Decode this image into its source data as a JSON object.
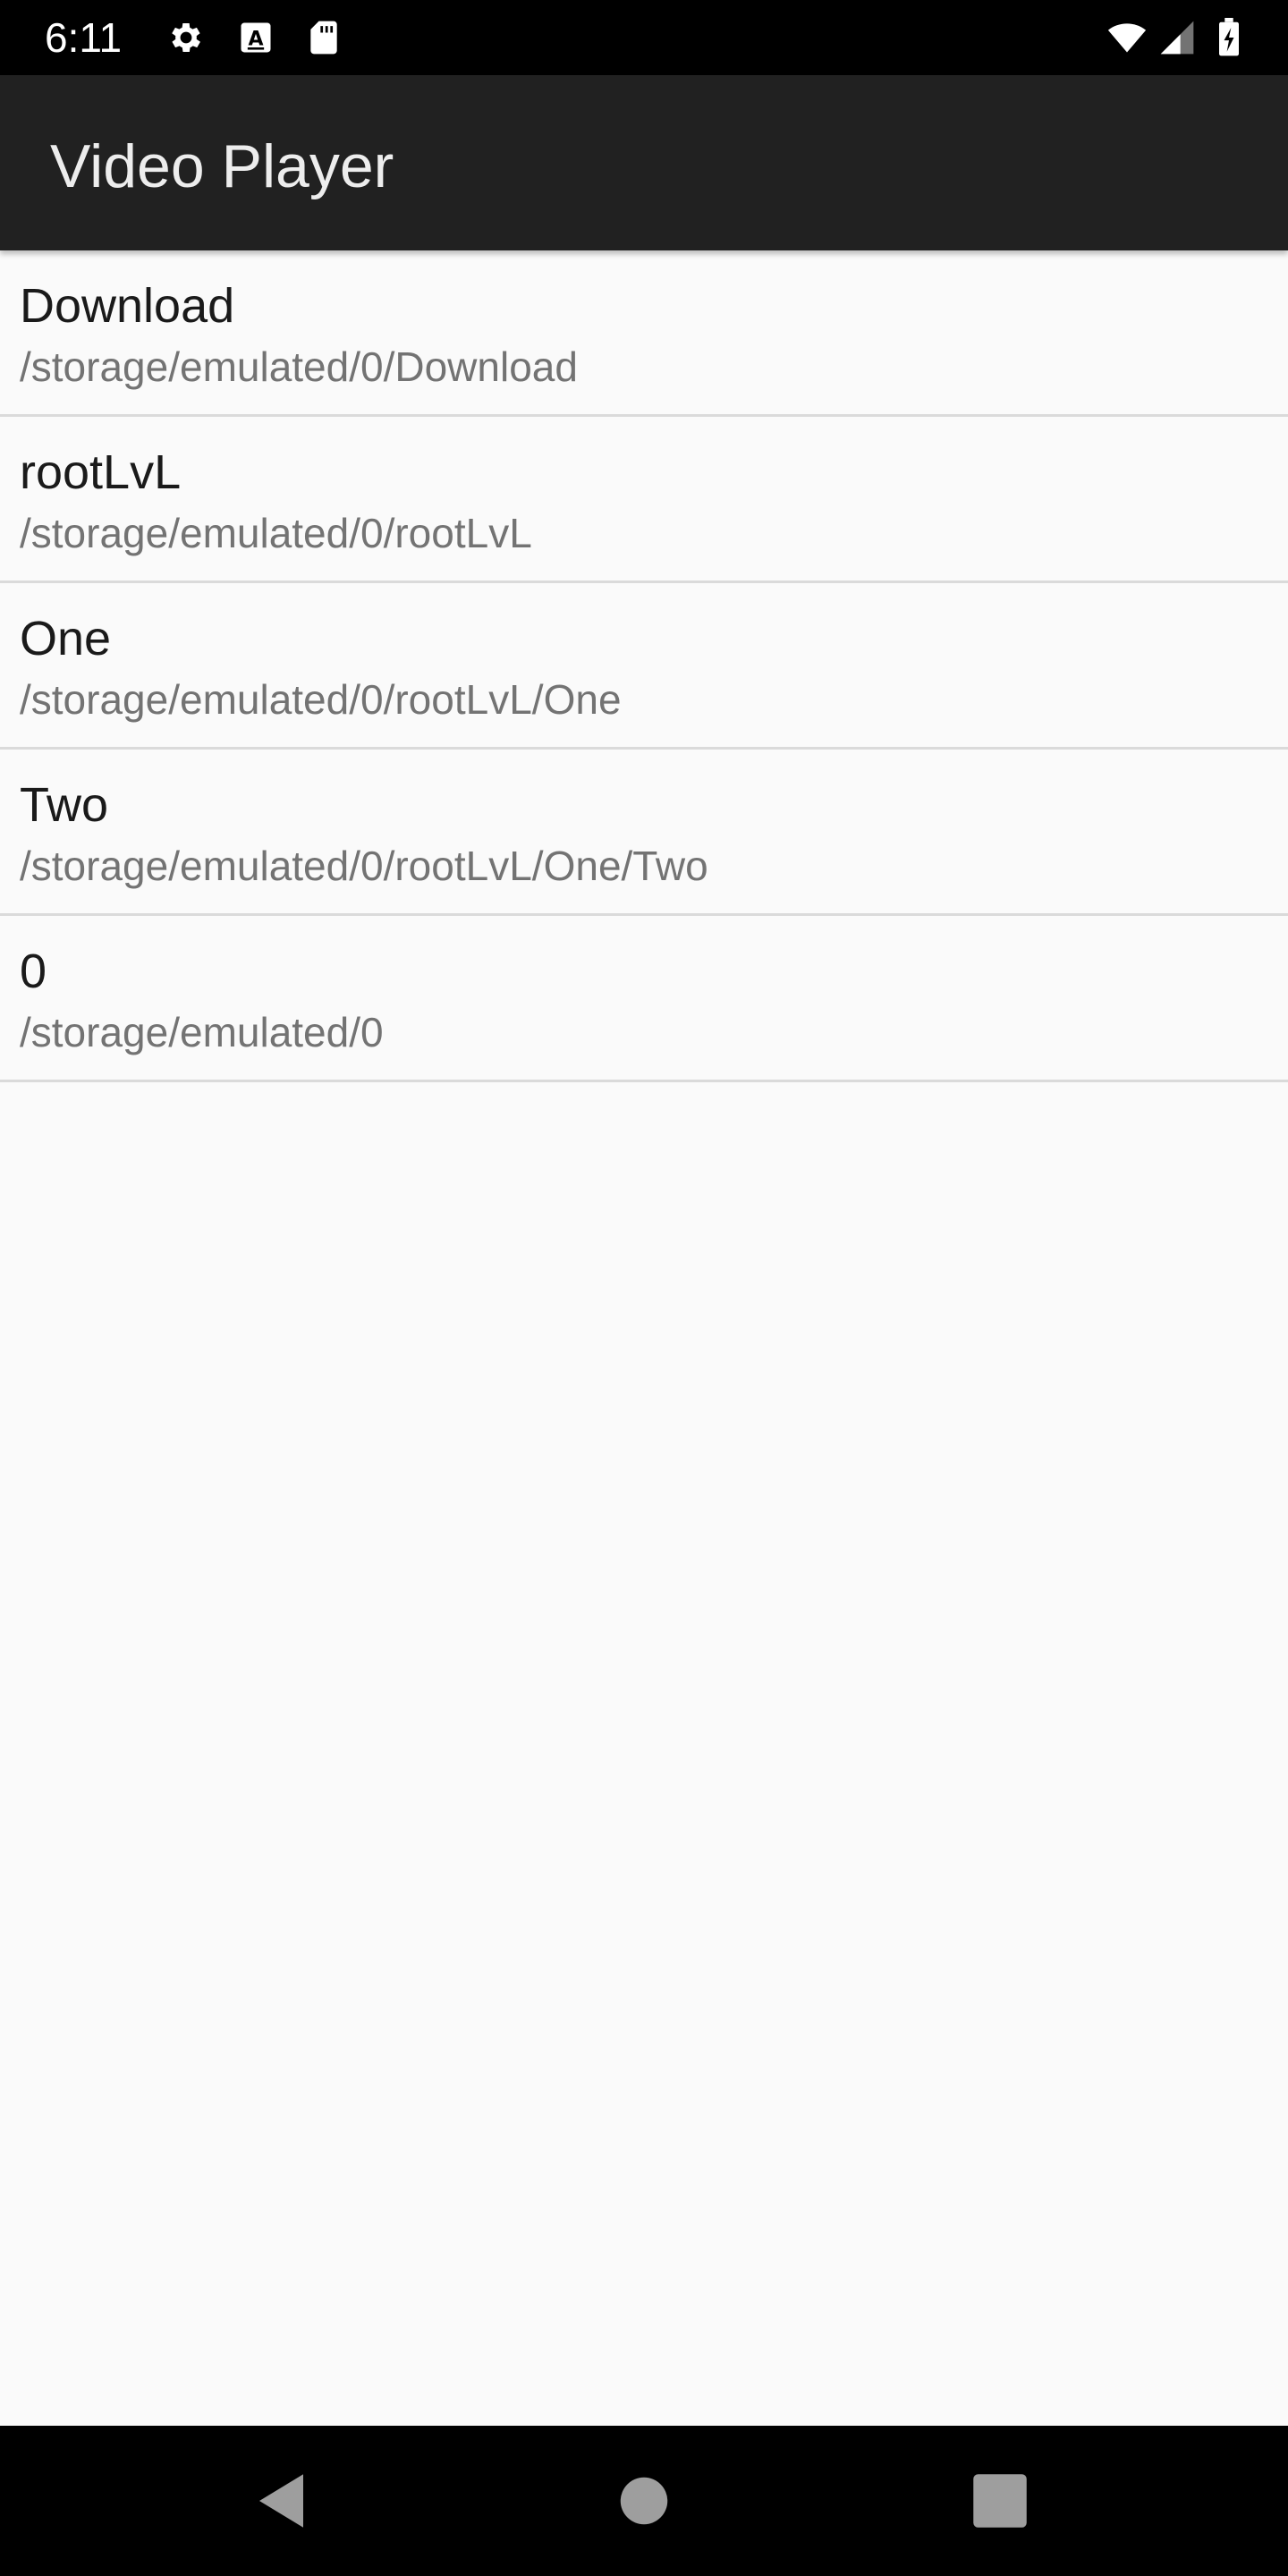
{
  "status_bar": {
    "time": "6:11",
    "icons": [
      "gear-icon",
      "a-badge-icon",
      "sd-card-icon",
      "wifi-icon",
      "signal-icon",
      "battery-charging-icon"
    ]
  },
  "app_bar": {
    "title": "Video Player"
  },
  "folders": [
    {
      "name": "Download",
      "path": "/storage/emulated/0/Download"
    },
    {
      "name": "rootLvL",
      "path": "/storage/emulated/0/rootLvL"
    },
    {
      "name": "One",
      "path": "/storage/emulated/0/rootLvL/One"
    },
    {
      "name": "Two",
      "path": "/storage/emulated/0/rootLvL/One/Two"
    },
    {
      "name": "0",
      "path": "/storage/emulated/0"
    }
  ],
  "nav_bar": {
    "buttons": [
      "back-icon",
      "home-icon",
      "recents-icon"
    ]
  },
  "colors": {
    "status_bar": "#000000",
    "app_bar": "#212121",
    "background": "#fafafa",
    "divider": "#dadada",
    "title_text": "#1a1a1a",
    "subtitle_text": "#737373"
  }
}
